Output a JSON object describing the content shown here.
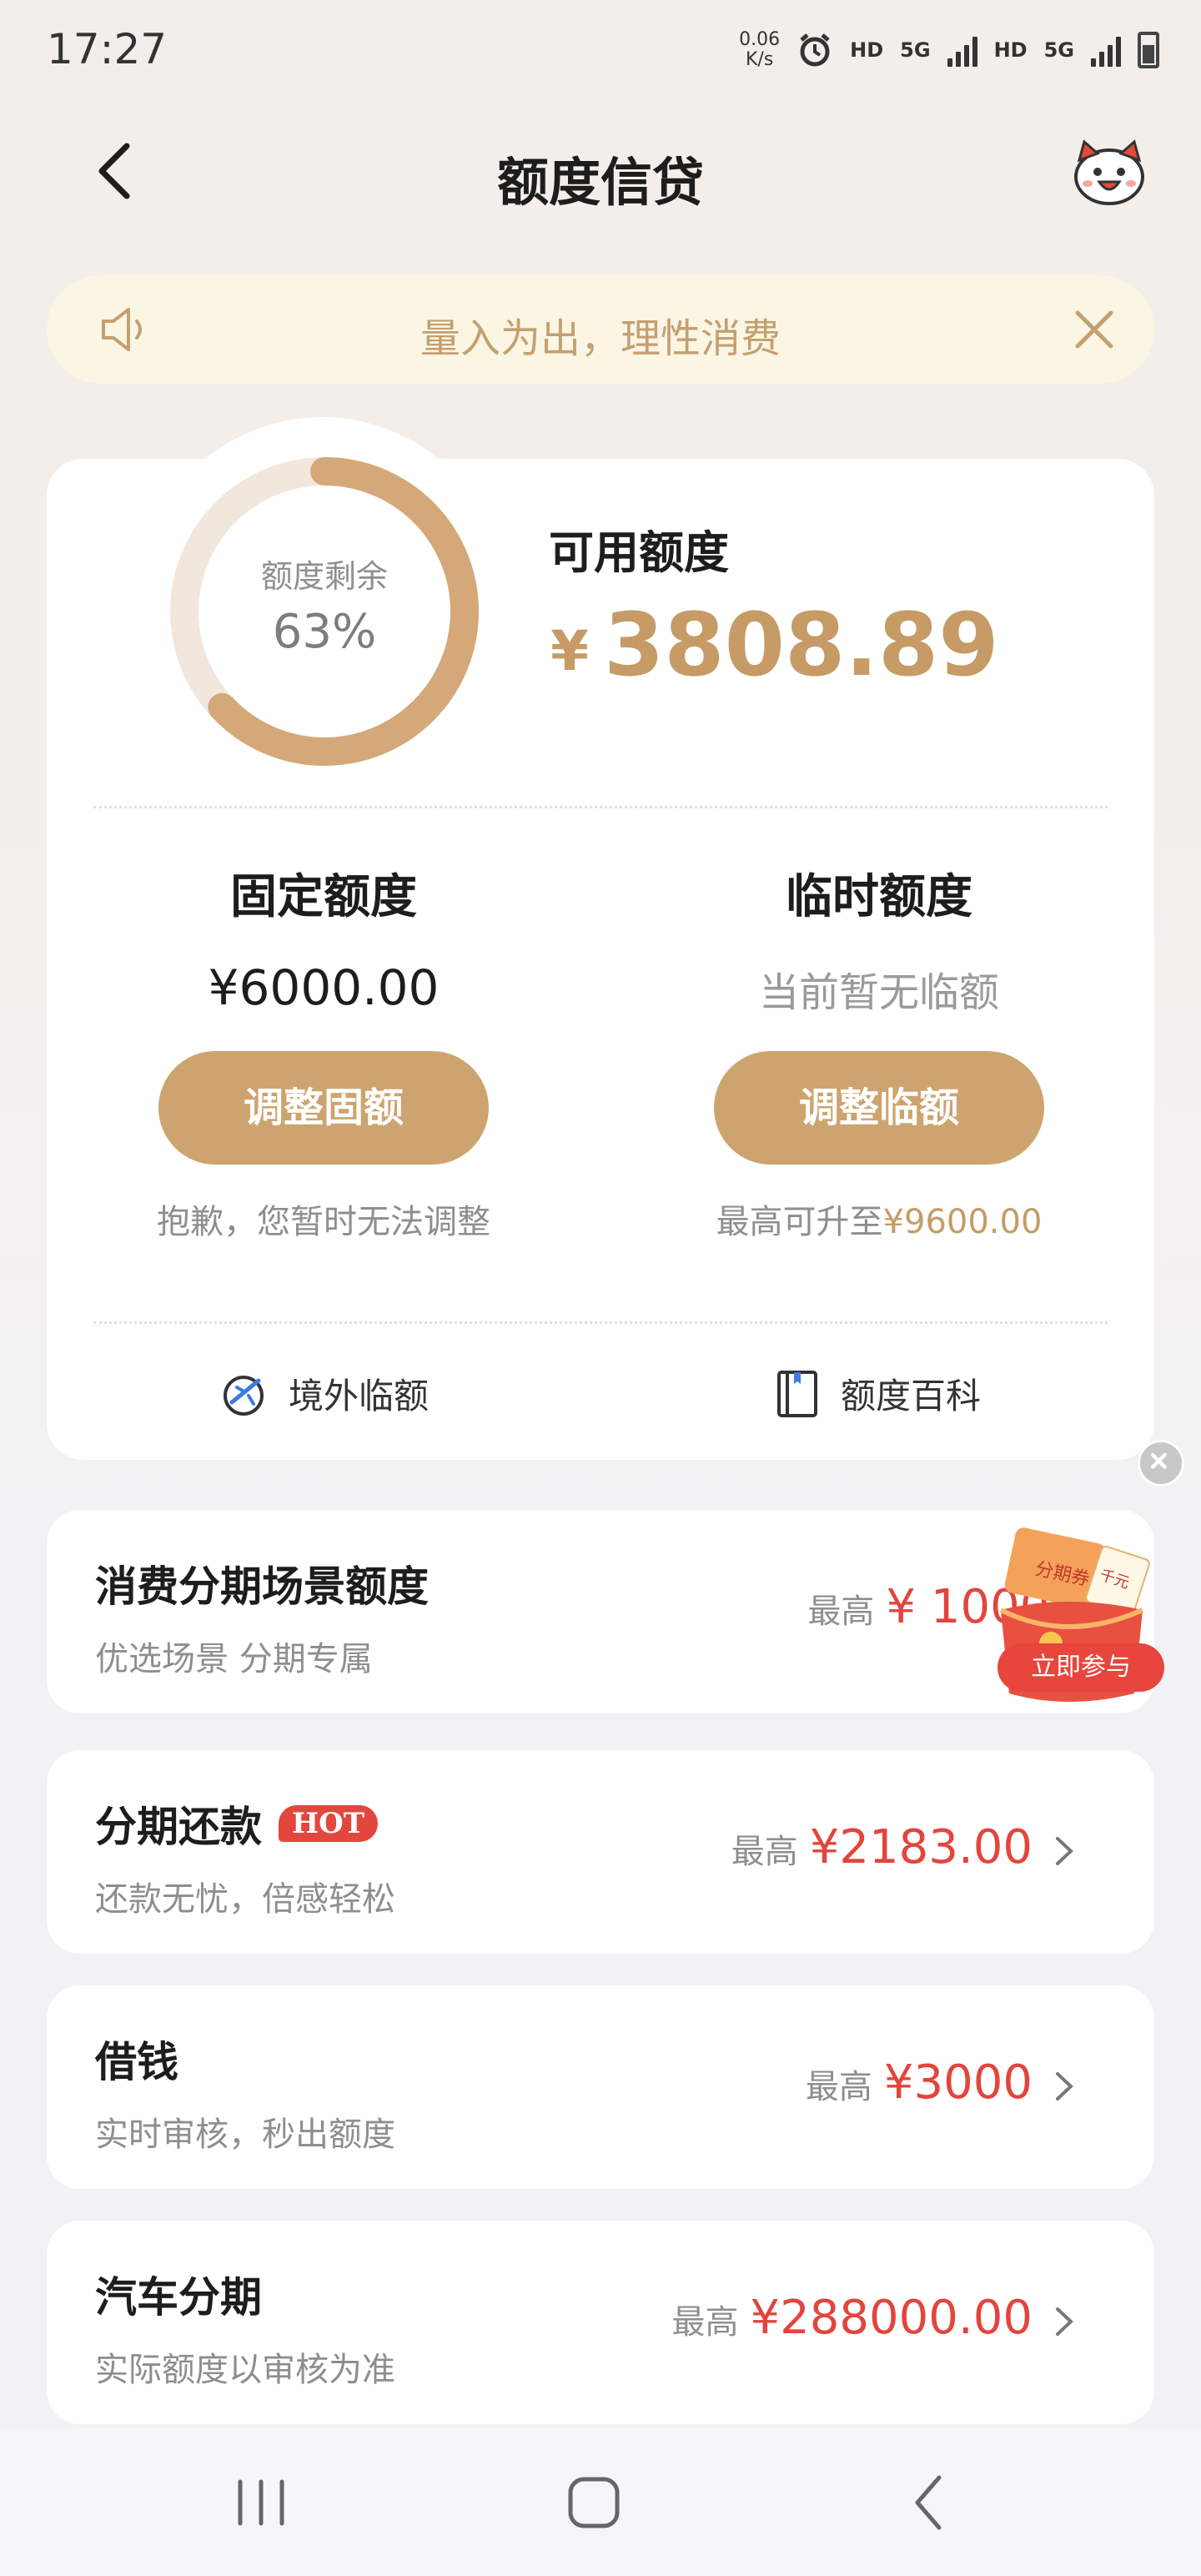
{
  "status_bar": {
    "time": "17:27",
    "net_speed_value": "0.06",
    "net_speed_unit": "K/s",
    "hd1": "HD",
    "net1": "5G",
    "hd2": "HD",
    "net2": "5G"
  },
  "header": {
    "title": "额度信贷",
    "back_icon": "chevron-left-icon",
    "mascot_icon": "mascot-icon"
  },
  "notice": {
    "text": "量入为出，理性消费",
    "speaker_icon": "speaker-icon",
    "close_icon": "close-icon"
  },
  "credit": {
    "ring_label": "额度剩余",
    "ring_value": "63%",
    "remaining_fraction": 0.63,
    "available_label": "可用额度",
    "currency": "¥",
    "available_amount": "3808.89",
    "fixed": {
      "title": "固定额度",
      "amount": "¥6000.00",
      "button": "调整固额",
      "note": "抱歉，您暂时无法调整"
    },
    "temp": {
      "title": "临时额度",
      "amount": "当前暂无临额",
      "button": "调整临额",
      "note_prefix": "最高可升至",
      "note_amount": "¥9600.00"
    },
    "links": [
      {
        "label": "境外临额",
        "icon": "plane-globe-icon"
      },
      {
        "label": "额度百科",
        "icon": "book-icon"
      }
    ]
  },
  "products": [
    {
      "title": "消费分期场景额度",
      "subtitle": "优选场景 分期专属",
      "prefix": "最高",
      "amount": "¥ 10000"
    },
    {
      "title": "分期还款",
      "badge": "HOT",
      "subtitle": "还款无忧，倍感轻松",
      "prefix": "最高",
      "amount": "¥2183.00"
    },
    {
      "title": "借钱",
      "subtitle": "实时审核，秒出额度",
      "prefix": "最高",
      "amount": "¥3000"
    },
    {
      "title": "汽车分期",
      "subtitle": "实际额度以审核为准",
      "prefix": "最高",
      "amount": "¥288000.00"
    }
  ],
  "promo": {
    "coupon_text": "分期券",
    "tag_text": "千元",
    "button": "立即参与",
    "close_icon": "close-icon"
  },
  "nav": {
    "recent_icon": "recent-apps-icon",
    "home_icon": "home-icon",
    "back_icon": "back-icon"
  },
  "colors": {
    "accent": "#c69b66",
    "button": "#cda46f",
    "price_red": "#e2453d",
    "notice_bg": "#fbf5e3",
    "notice_text": "#c4a071"
  }
}
